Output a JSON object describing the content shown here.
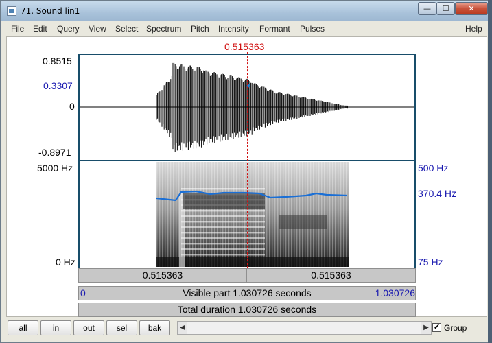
{
  "window": {
    "title": "71. Sound lin1"
  },
  "window_buttons": {
    "minimize": "—",
    "maximize": "☐",
    "close": "✕"
  },
  "menu": [
    "File",
    "Edit",
    "Query",
    "View",
    "Select",
    "Spectrum",
    "Pitch",
    "Intensity",
    "Formant",
    "Pulses"
  ],
  "help": "Help",
  "cursor": {
    "time_label": "0.515363",
    "time_fraction": 0.5
  },
  "waveform": {
    "max_label": "0.8515",
    "cursor_value": "0.3307",
    "zero_label": "0",
    "min_label": "-0.8971"
  },
  "spectrogram": {
    "top_label": "5000 Hz",
    "bottom_label": "0 Hz"
  },
  "pitch": {
    "top_label": "500 Hz",
    "current_label": "370.4 Hz",
    "bottom_label": "75 Hz"
  },
  "time_bar": {
    "left_segment": "0.515363",
    "right_segment": "0.515363"
  },
  "visible_bar": {
    "start": "0",
    "text": "Visible part 1.030726 seconds",
    "end": "1.030726"
  },
  "total_bar": {
    "text": "Total duration 1.030726 seconds"
  },
  "zoom_buttons": [
    "all",
    "in",
    "out",
    "sel",
    "bak"
  ],
  "scroll": {
    "left_arrow": "◀",
    "right_arrow": "▶"
  },
  "group": {
    "label": "Group",
    "checked": true,
    "check_mark": "✔"
  }
}
